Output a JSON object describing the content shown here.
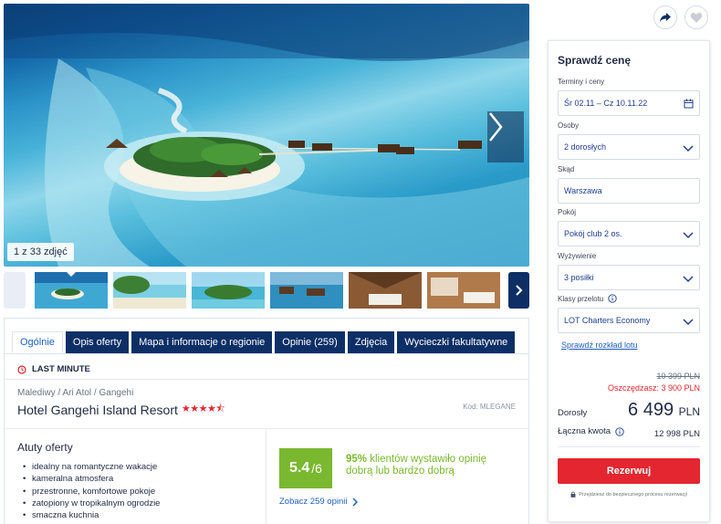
{
  "gallery": {
    "counter": "1 z 33 zdjęć",
    "thumbnail_count": 6
  },
  "tabs": [
    {
      "label": "Ogólnie",
      "active": true
    },
    {
      "label": "Opis oferty"
    },
    {
      "label": "Mapa i informacje o regionie"
    },
    {
      "label": "Opinie (259)"
    },
    {
      "label": "Zdjęcia"
    },
    {
      "label": "Wycieczki fakultatywne"
    }
  ],
  "offer": {
    "badge": "LAST MINUTE",
    "breadcrumb": "Malediwy / Ari Atol / Gangehi",
    "hotel_name": "Hotel Gangehi Island Resort",
    "stars": "★★★★⯪",
    "star_rating": 4.5,
    "code": "Kod: MLEGANE",
    "highlights_title": "Atuty oferty",
    "highlights": [
      "idealny na romantyczne wakacje",
      "kameralna atmosfera",
      "przestronne, komfortowe pokoje",
      "zatopiony w tropikalnym ogrodzie",
      "smaczna kuchnia"
    ]
  },
  "rating": {
    "score": "5.4",
    "scale": "/6",
    "percent": "95%",
    "text": "klientów wystawiło opinię dobrą lub bardzo dobrą",
    "link": "Zobacz 259 opinii"
  },
  "price_panel": {
    "title": "Sprawdź cenę",
    "dates_label": "Terminy i ceny",
    "dates_value": "Śr 02.11 – Cz 10.11.22",
    "persons_label": "Osoby",
    "persons_value": "2 dorosłych",
    "from_label": "Skąd",
    "from_value": "Warszawa",
    "room_label": "Pokój",
    "room_value": "Pokój club 2 os.",
    "board_label": "Wyżywienie",
    "board_value": "3 posiłki",
    "flight_class_label": "Klasy przelotu",
    "flight_class_value": "LOT Charters Economy",
    "flight_schedule_link": "Sprawdź rozkład lotu",
    "old_price": "10 399 PLN",
    "savings": "Oszczędzasz: 3 900 PLN",
    "adult_label": "Dorosły",
    "adult_price": "6 499",
    "adult_currency": "PLN",
    "total_label": "Łączna kwota",
    "total_value": "12 998 PLN",
    "book_button": "Rezerwuj",
    "secure_note": "Przejdziesz do bezpiecznego procesu rezerwacji"
  },
  "icons": {
    "share": "share-icon",
    "favorite": "heart-icon",
    "calendar": "calendar-icon",
    "chevron": "chevron-down-icon",
    "info": "info-icon",
    "lock": "lock-icon",
    "clock": "clock-icon"
  },
  "colors": {
    "navy": "#0d2f66",
    "link": "#1f5fbf",
    "red": "#e3262f",
    "green": "#7ab82f"
  }
}
